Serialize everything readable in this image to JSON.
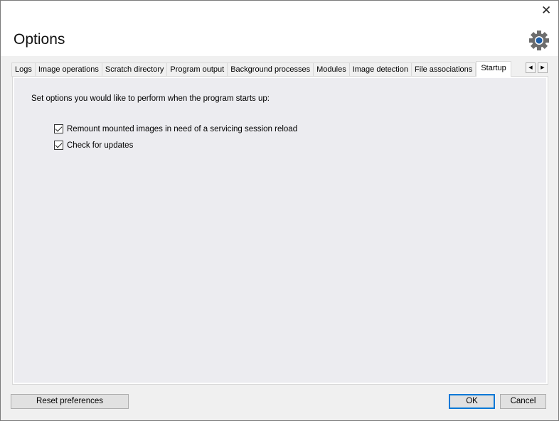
{
  "window": {
    "title": "Options",
    "close_icon": "close-icon",
    "settings_icon": "gear-icon",
    "accent": "#0078d7"
  },
  "tabs": [
    {
      "label": "Logs"
    },
    {
      "label": "Image operations"
    },
    {
      "label": "Scratch directory"
    },
    {
      "label": "Program output"
    },
    {
      "label": "Background processes"
    },
    {
      "label": "Modules"
    },
    {
      "label": "Image detection"
    },
    {
      "label": "File associations"
    },
    {
      "label": "Startup",
      "active": true
    }
  ],
  "startup": {
    "intro": "Set options you would like to perform when the program starts up:",
    "options": [
      {
        "label": "Remount mounted images in need of a servicing session reload",
        "checked": true
      },
      {
        "label": "Check for updates",
        "checked": true
      }
    ]
  },
  "footer": {
    "reset": "Reset preferences",
    "ok": "OK",
    "cancel": "Cancel"
  }
}
